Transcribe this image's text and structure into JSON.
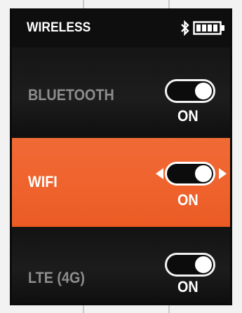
{
  "statusbar": {
    "title": "WIRELESS",
    "bluetooth_icon": "bluetooth-icon",
    "battery_icon": "battery-icon",
    "battery_level_bars": 4
  },
  "rows": [
    {
      "label": "BLUETOOTH",
      "state": "ON",
      "selected": false
    },
    {
      "label": "WIFI",
      "state": "ON",
      "selected": true
    },
    {
      "label": "LTE (4G)",
      "state": "ON",
      "selected": false
    }
  ],
  "colors": {
    "selected_row": "#ef622c",
    "row_background": "#161616",
    "inactive_label": "#8d8d8d",
    "text": "#ffffff"
  }
}
